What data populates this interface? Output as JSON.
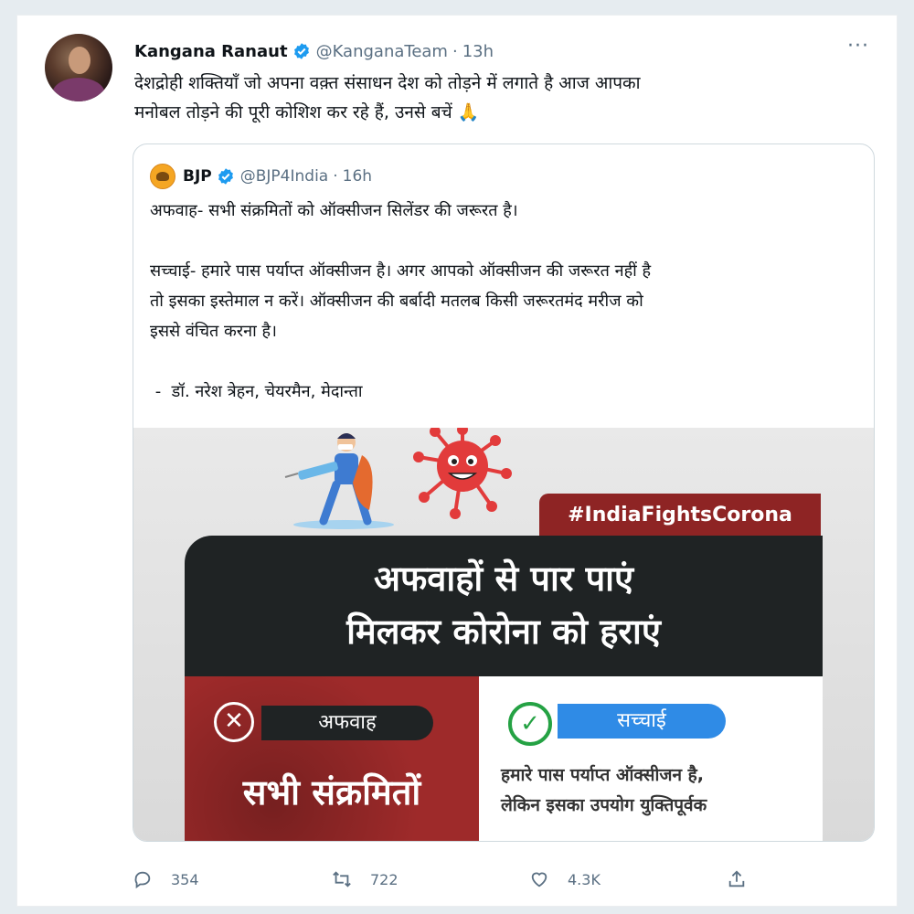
{
  "tweet": {
    "author_name": "Kangana Ranaut",
    "handle": "@KanganaTeam",
    "separator": "·",
    "time": "13h",
    "more_label": "···",
    "text": "देशद्रोही शक्तियाँ जो अपना वक़्त संसाधन देश को तोड़ने में लगाते है आज आपका\nमनोबल तोड़ने की पूरी कोशिश कर रहे हैं, उनसे बचें 🙏",
    "verified_icon": "verified-badge-icon",
    "verified_color": "#1d9bf0"
  },
  "quoted": {
    "author_name": "BJP",
    "handle": "@BJP4India",
    "separator": "·",
    "time": "16h",
    "text": "अफवाह- सभी संक्रमितों को ऑक्सीजन सिलेंडर की जरूरत है।\n\nसच्चाई- हमारे पास पर्याप्त ऑक्सीजन है। अगर आपको ऑक्सीजन की जरूरत नहीं है\nतो इसका इस्तेमाल न करें। ऑक्सीजन की बर्बादी मतलब किसी जरूरतमंद मरीज को\nइससे वंचित करना है।\n\n -  डॉ. नरेश त्रेहन, चेयरमैन, मेदान्ता",
    "media": {
      "hashtag": "#IndiaFightsCorona",
      "banner_line1": "अफवाहों से पार पाएं",
      "banner_line2": "मिलकर कोरोना को हराएं",
      "rumor_label": "अफवाह",
      "rumor_text": "सभी संक्रमितों",
      "truth_label": "सच्चाई",
      "truth_text_line1": "हमारे पास पर्याप्त ऑक्सीजन है,",
      "truth_text_line2": "लेकिन इसका उपयोग युक्तिपूर्वक",
      "colors": {
        "hashtag_bg": "#8e2424",
        "banner_bg": "#1f2324",
        "rumor_bg": "#9e2a2a",
        "truth_pill": "#2f8be6",
        "check": "#25a244",
        "virus": "#e23b3b"
      }
    }
  },
  "actions": {
    "reply_count": "354",
    "retweet_count": "722",
    "like_count": "4.3K",
    "icons": [
      "reply-icon",
      "retweet-icon",
      "like-icon",
      "share-icon"
    ]
  }
}
